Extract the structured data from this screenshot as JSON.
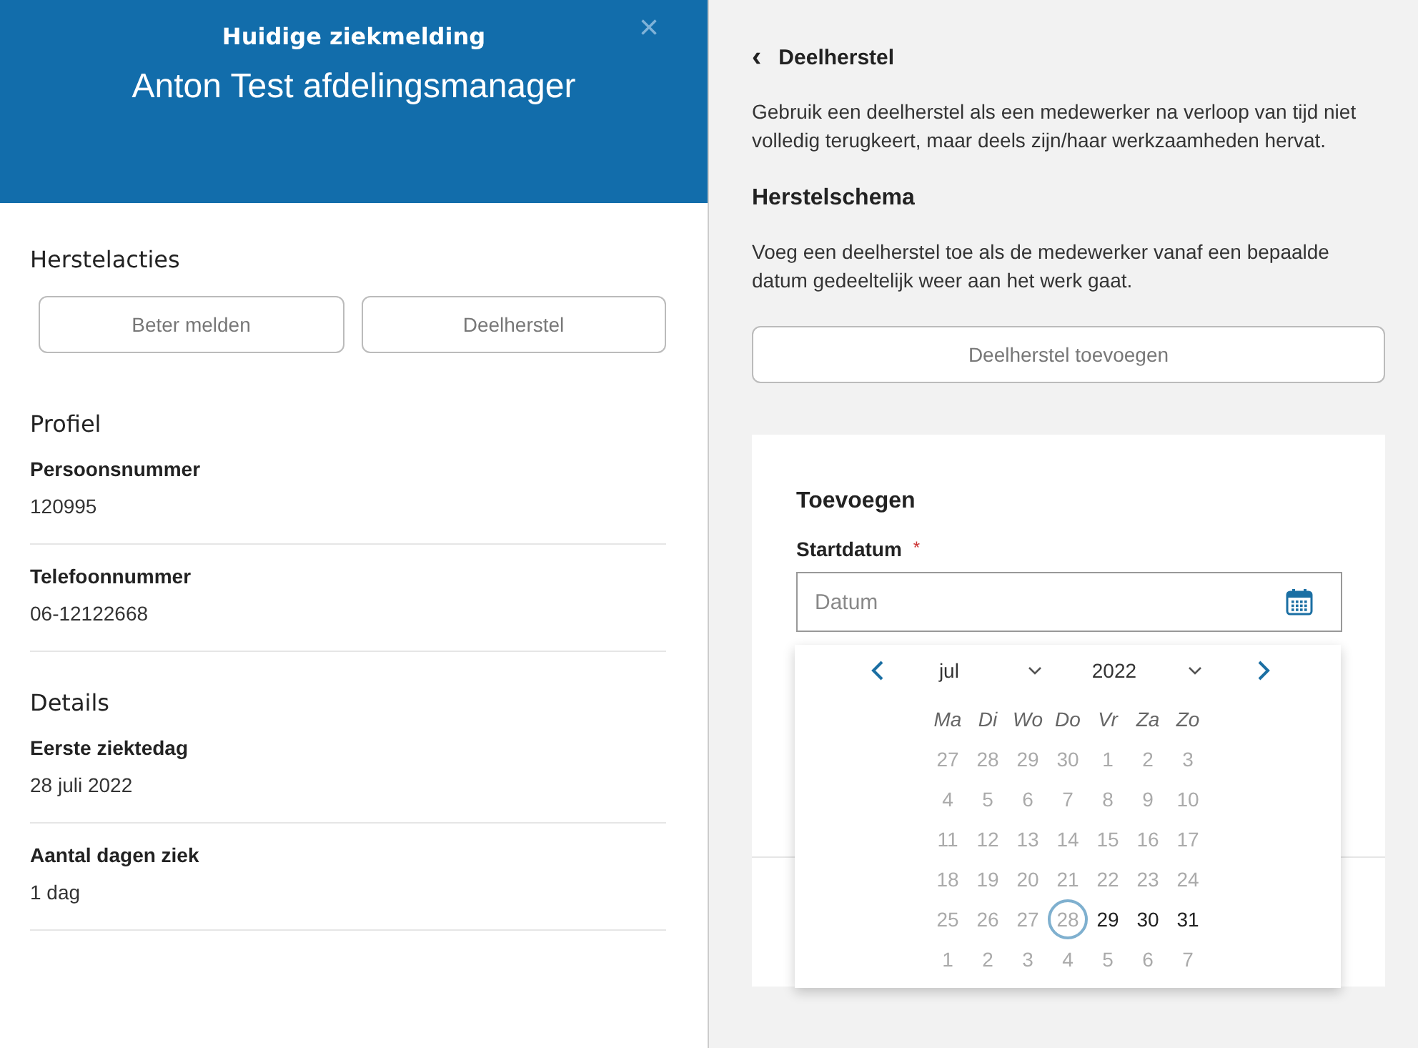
{
  "header": {
    "subtitle": "Huidige ziekmelding",
    "title": "Anton Test afdelingsmanager",
    "close": "×"
  },
  "recovery": {
    "heading": "Herstelacties",
    "buttons": [
      "Beter melden",
      "Deelherstel"
    ]
  },
  "profile": {
    "heading": "Profiel",
    "fields": [
      {
        "label": "Persoonsnummer",
        "value": "120995"
      },
      {
        "label": "Telefoonnummer",
        "value": "06-12122668"
      }
    ]
  },
  "details": {
    "heading": "Details",
    "fields": [
      {
        "label": "Eerste ziektedag",
        "value": "28 juli 2022"
      },
      {
        "label": "Aantal dagen ziek",
        "value": "1 dag"
      }
    ]
  },
  "panel": {
    "back": "‹",
    "title": "Deelherstel",
    "intro": "Gebruik een deelherstel als een medewerker na verloop van tijd niet volledig terugkeert, maar deels zijn/haar werkzaamheden hervat.",
    "schema_heading": "Herstelschema",
    "schema_text": "Voeg een deelherstel toe als de medewerker vanaf een bepaalde datum gedeeltelijk weer aan het werk gaat.",
    "add_button": "Deelherstel toevoegen"
  },
  "form": {
    "heading": "Toevoegen",
    "label": "Startdatum",
    "required": "*",
    "placeholder": "Datum"
  },
  "calendar": {
    "month": "jul",
    "year": "2022",
    "weekdays": [
      "Ma",
      "Di",
      "Wo",
      "Do",
      "Vr",
      "Za",
      "Zo"
    ],
    "weeks": [
      [
        {
          "d": "27",
          "disabled": true,
          "today": false
        },
        {
          "d": "28",
          "disabled": true,
          "today": false
        },
        {
          "d": "29",
          "disabled": true,
          "today": false
        },
        {
          "d": "30",
          "disabled": true,
          "today": false
        },
        {
          "d": "1",
          "disabled": true,
          "today": false
        },
        {
          "d": "2",
          "disabled": true,
          "today": false
        },
        {
          "d": "3",
          "disabled": true,
          "today": false
        }
      ],
      [
        {
          "d": "4",
          "disabled": true,
          "today": false
        },
        {
          "d": "5",
          "disabled": true,
          "today": false
        },
        {
          "d": "6",
          "disabled": true,
          "today": false
        },
        {
          "d": "7",
          "disabled": true,
          "today": false
        },
        {
          "d": "8",
          "disabled": true,
          "today": false
        },
        {
          "d": "9",
          "disabled": true,
          "today": false
        },
        {
          "d": "10",
          "disabled": true,
          "today": false
        }
      ],
      [
        {
          "d": "11",
          "disabled": true,
          "today": false
        },
        {
          "d": "12",
          "disabled": true,
          "today": false
        },
        {
          "d": "13",
          "disabled": true,
          "today": false
        },
        {
          "d": "14",
          "disabled": true,
          "today": false
        },
        {
          "d": "15",
          "disabled": true,
          "today": false
        },
        {
          "d": "16",
          "disabled": true,
          "today": false
        },
        {
          "d": "17",
          "disabled": true,
          "today": false
        }
      ],
      [
        {
          "d": "18",
          "disabled": true,
          "today": false
        },
        {
          "d": "19",
          "disabled": true,
          "today": false
        },
        {
          "d": "20",
          "disabled": true,
          "today": false
        },
        {
          "d": "21",
          "disabled": true,
          "today": false
        },
        {
          "d": "22",
          "disabled": true,
          "today": false
        },
        {
          "d": "23",
          "disabled": true,
          "today": false
        },
        {
          "d": "24",
          "disabled": true,
          "today": false
        }
      ],
      [
        {
          "d": "25",
          "disabled": true,
          "today": false
        },
        {
          "d": "26",
          "disabled": true,
          "today": false
        },
        {
          "d": "27",
          "disabled": true,
          "today": false
        },
        {
          "d": "28",
          "disabled": true,
          "today": true
        },
        {
          "d": "29",
          "disabled": false,
          "today": false
        },
        {
          "d": "30",
          "disabled": false,
          "today": false
        },
        {
          "d": "31",
          "disabled": false,
          "today": false
        }
      ],
      [
        {
          "d": "1",
          "disabled": true,
          "today": false
        },
        {
          "d": "2",
          "disabled": true,
          "today": false
        },
        {
          "d": "3",
          "disabled": true,
          "today": false
        },
        {
          "d": "4",
          "disabled": true,
          "today": false
        },
        {
          "d": "5",
          "disabled": true,
          "today": false
        },
        {
          "d": "6",
          "disabled": true,
          "today": false
        },
        {
          "d": "7",
          "disabled": true,
          "today": false
        }
      ]
    ]
  }
}
